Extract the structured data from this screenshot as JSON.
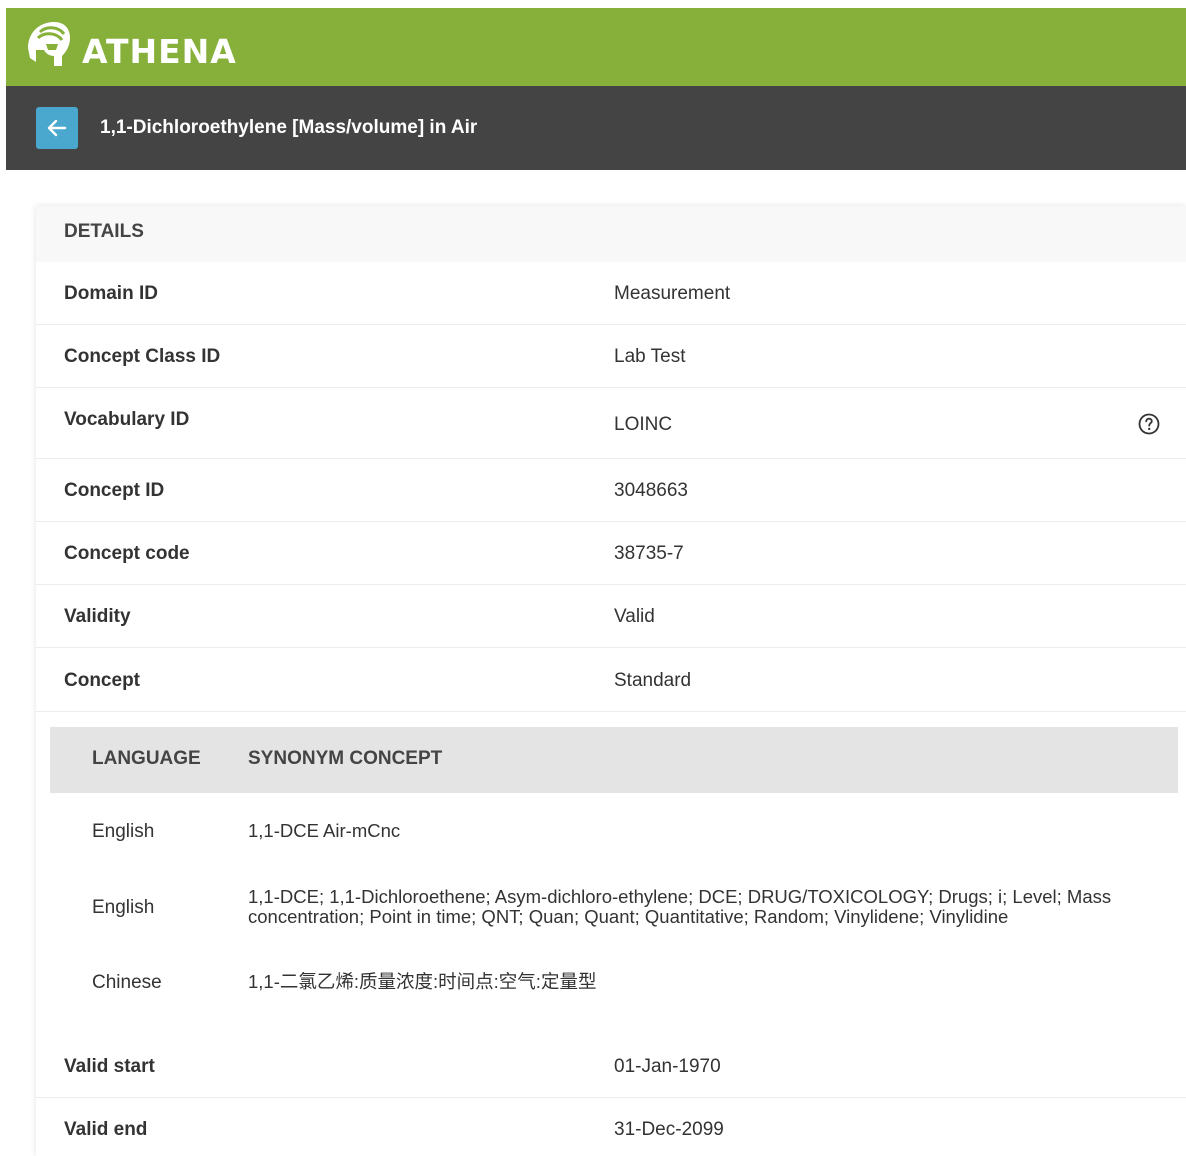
{
  "brand": {
    "name": "ATHENA",
    "logo_icon": "helmet-logo-icon",
    "color": "#86b03a"
  },
  "header": {
    "back_icon": "arrow-left-icon",
    "title": "1,1-Dichloroethylene [Mass/volume] in Air"
  },
  "details": {
    "section_title": "DETAILS",
    "rows": [
      {
        "label": "Domain ID",
        "value": "Measurement"
      },
      {
        "label": "Concept Class ID",
        "value": "Lab Test"
      },
      {
        "label": "Vocabulary ID",
        "value": "LOINC",
        "icon": "help-circle-icon"
      },
      {
        "label": "Concept ID",
        "value": "3048663"
      },
      {
        "label": "Concept code",
        "value": "38735-7"
      },
      {
        "label": "Validity",
        "value": "Valid"
      },
      {
        "label": "Concept",
        "value": "Standard"
      }
    ],
    "synonyms": {
      "columns": [
        "LANGUAGE",
        "SYNONYM CONCEPT"
      ],
      "rows": [
        {
          "language": "English",
          "synonym": "1,1-DCE Air-mCnc"
        },
        {
          "language": "English",
          "synonym": "1,1-DCE; 1,1-Dichloroethene; Asym-dichloro-ethylene; DCE; DRUG/TOXICOLOGY; Drugs; i; Level; Mass concentration; Point in time; QNT; Quan; Quant; Quantitative; Random; Vinylidene; Vinylidine"
        },
        {
          "language": "Chinese",
          "synonym": "1,1-二氯乙烯:质量浓度:时间点:空气:定量型"
        }
      ]
    },
    "validity_rows": [
      {
        "label": "Valid start",
        "value": "01-Jan-1970"
      },
      {
        "label": "Valid end",
        "value": "31-Dec-2099"
      }
    ]
  },
  "colors": {
    "title_bar": "#444444",
    "back_button": "#4aa8cf",
    "synonym_header": "#e4e4e4"
  }
}
